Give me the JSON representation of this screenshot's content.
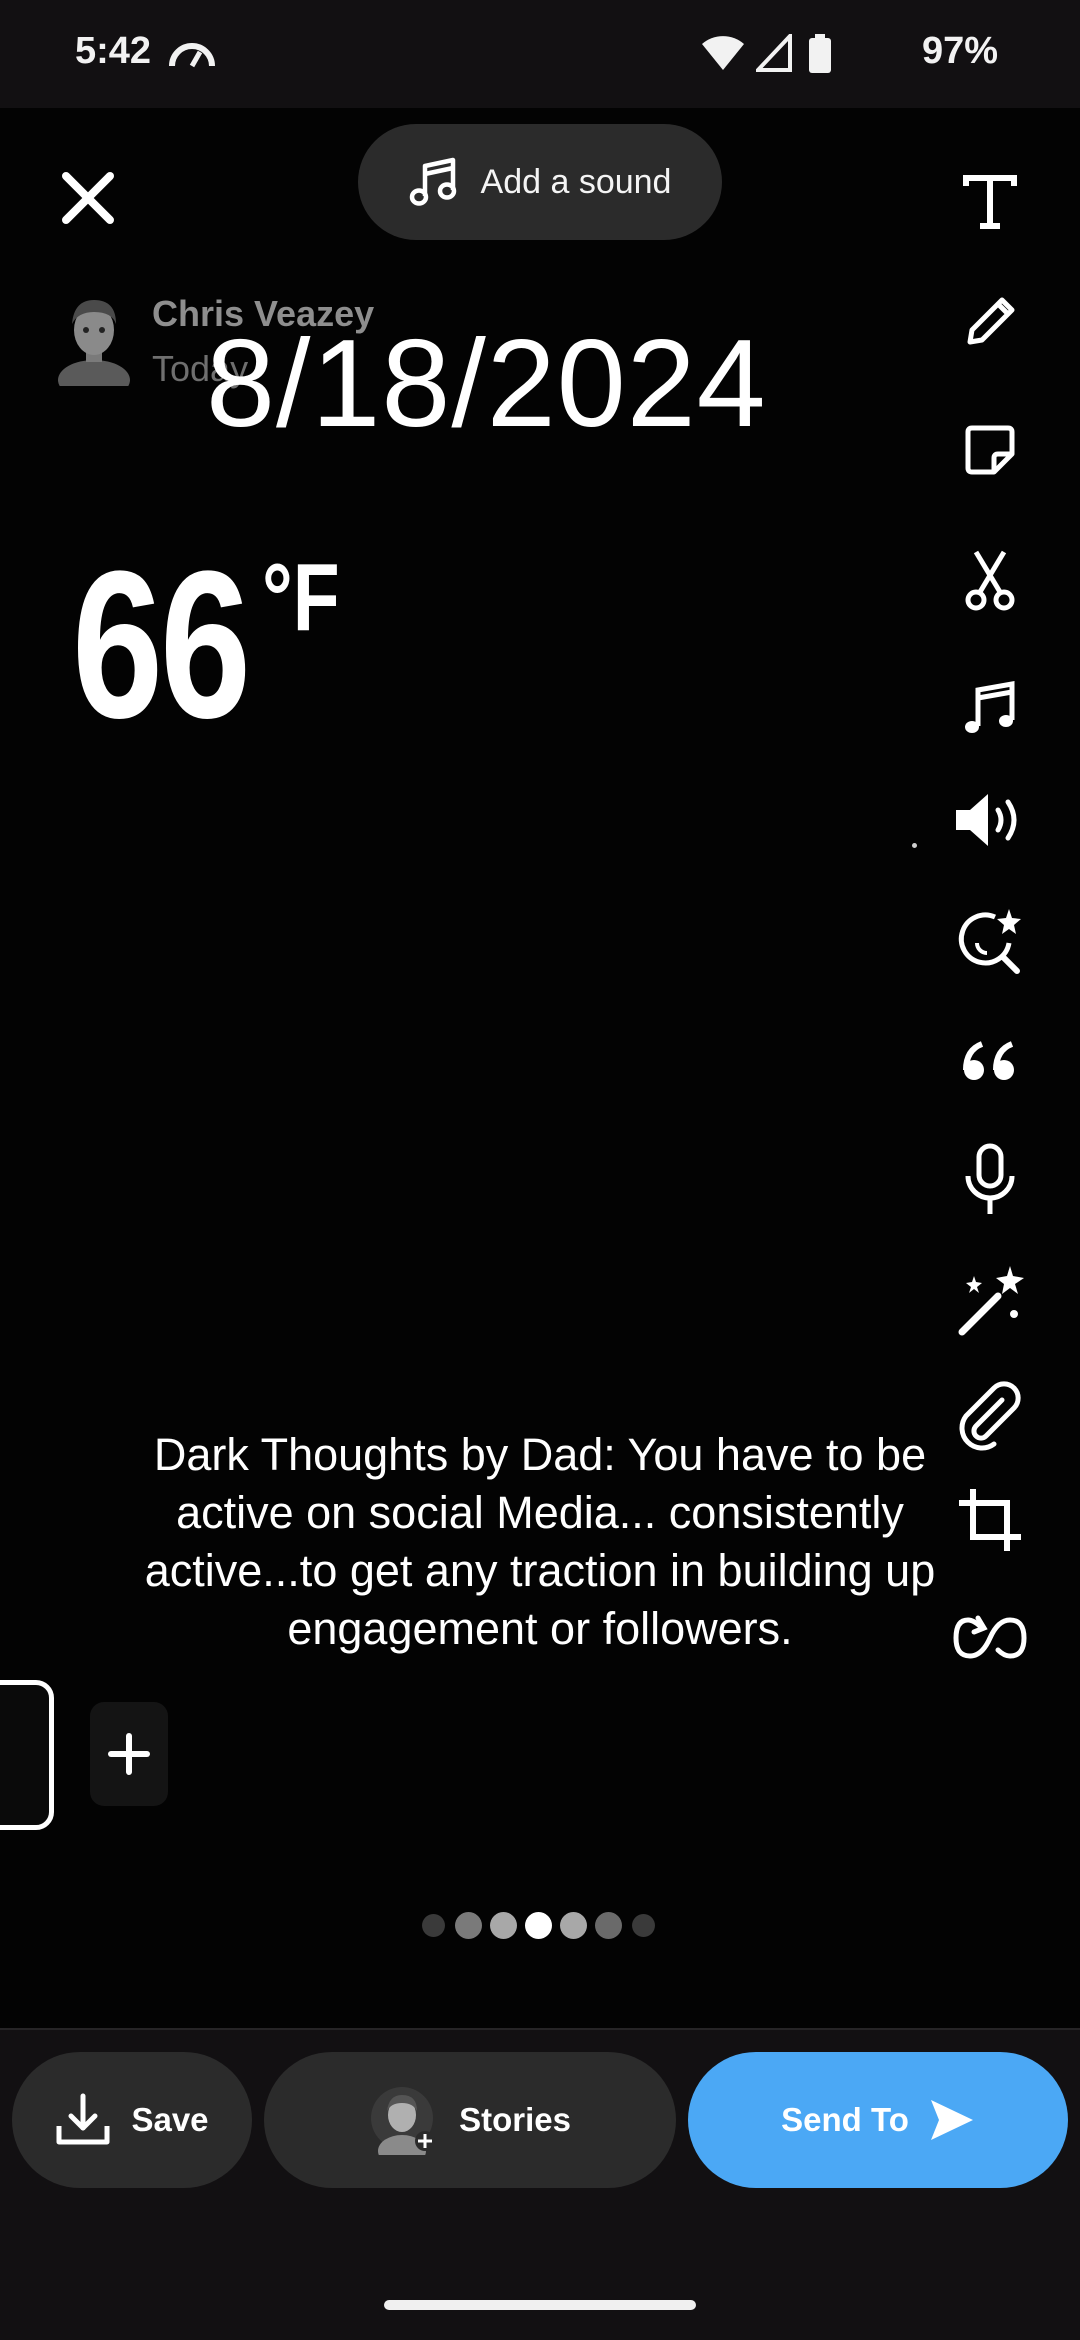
{
  "status_bar": {
    "time": "5:42",
    "battery": "97%"
  },
  "editor": {
    "add_sound_label": "Add a sound",
    "author_name": "Chris Veazey",
    "author_time": "Today",
    "date_sticker": "8/18/2024",
    "temperature": "66",
    "temperature_unit": "°F",
    "caption": "Dark Thoughts by Dad: You have to be active on social Media... consistently active...to get any traction in building up engagement or followers."
  },
  "tools": [
    "text-icon",
    "pen-icon",
    "sticker-icon",
    "scissors-icon",
    "music-note-icon",
    "volume-icon",
    "lens-explore-icon",
    "quote-icon",
    "microphone-icon",
    "magic-wand-icon",
    "paperclip-icon",
    "crop-icon",
    "loop-icon"
  ],
  "pagination": {
    "total": 7,
    "current": 3
  },
  "actions": {
    "save_label": "Save",
    "stories_label": "Stories",
    "send_label": "Send To"
  },
  "colors": {
    "send_accent": "#4ba8f5",
    "pill_bg": "#2b2b2b"
  }
}
